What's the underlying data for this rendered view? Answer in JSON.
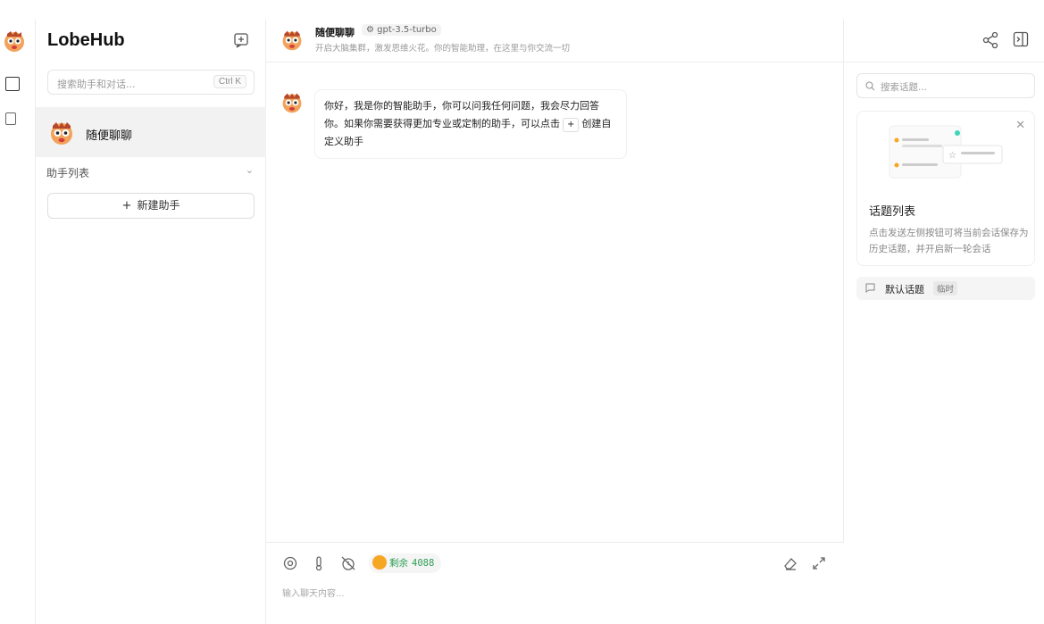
{
  "app": {
    "name": "LobeHub"
  },
  "sidebar": {
    "search": {
      "placeholder": "搜索助手和对话...",
      "shortcut": "Ctrl K"
    },
    "sessions": [
      {
        "title": "随便聊聊",
        "active": true
      }
    ],
    "group_label": "助手列表",
    "add_assistant_label": "新建助手"
  },
  "chat": {
    "title": "随便聊聊",
    "model": "gpt-3.5-turbo",
    "description": "开启大脑集群，激发思维火花。你的智能助理，在这里与你交流一切",
    "messages": [
      {
        "role": "assistant",
        "text_before": "你好，我是你的智能助手，你可以问我任何问题，我会尽力回答你。如果你需要获得更加专业或定制的助手，可以点击",
        "chip": "+",
        "text_after": "创建自定义助手"
      }
    ],
    "input": {
      "placeholder": "输入聊天内容...",
      "token_label": "剩余",
      "token_value": "4088"
    }
  },
  "topics": {
    "search_placeholder": "搜索话题...",
    "guide": {
      "title": "话题列表",
      "description": "点击发送左侧按钮可将当前会话保存为历史话题，并开启新一轮会话"
    },
    "items": [
      {
        "label": "默认话题",
        "badge": "临时"
      }
    ]
  },
  "colors": {
    "accent": "#2e9e54",
    "active_bg": "#f2f2f2",
    "border": "#ececec"
  }
}
